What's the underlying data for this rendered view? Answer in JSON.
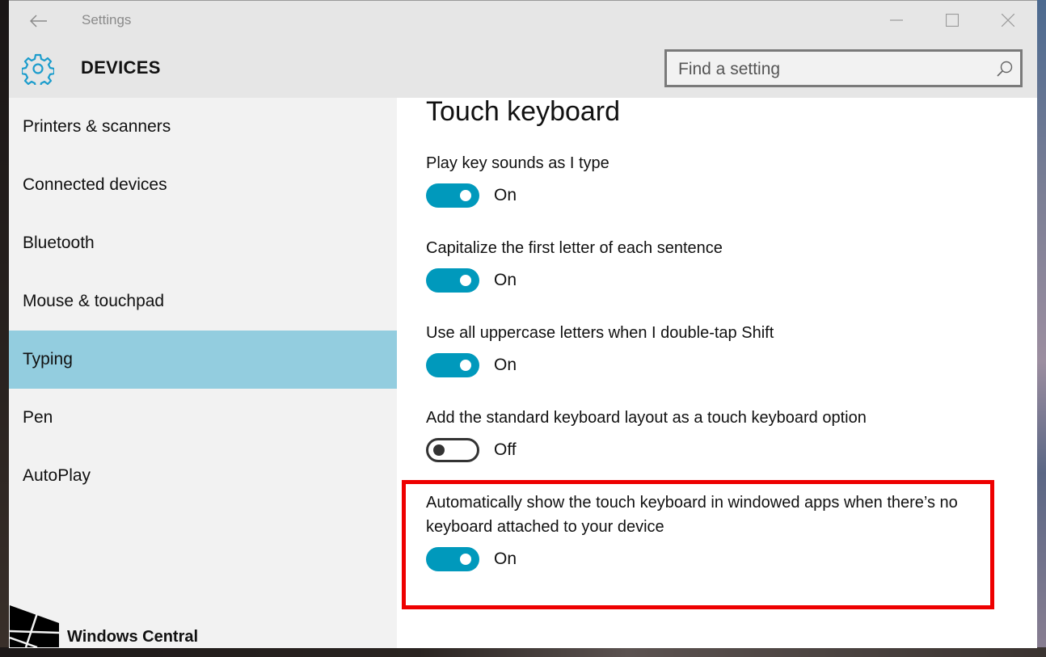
{
  "window": {
    "app_title": "Settings",
    "section_title": "DEVICES",
    "icons": {
      "back": "back-arrow-icon",
      "minimize": "minimize-icon",
      "maximize": "maximize-icon",
      "close": "close-icon",
      "section": "gear-icon",
      "search": "search-icon"
    }
  },
  "search": {
    "placeholder": "Find a setting",
    "value": ""
  },
  "sidebar": {
    "items": [
      {
        "label": "Printers & scanners",
        "selected": false
      },
      {
        "label": "Connected devices",
        "selected": false
      },
      {
        "label": "Bluetooth",
        "selected": false
      },
      {
        "label": "Mouse & touchpad",
        "selected": false
      },
      {
        "label": "Typing",
        "selected": true
      },
      {
        "label": "Pen",
        "selected": false
      },
      {
        "label": "AutoPlay",
        "selected": false
      }
    ]
  },
  "content": {
    "title": "Touch keyboard",
    "settings": [
      {
        "label": "Play key sounds as I type",
        "state": "On",
        "enabled": true
      },
      {
        "label": "Capitalize the first letter of each sentence",
        "state": "On",
        "enabled": true
      },
      {
        "label": "Use all uppercase letters when I double-tap Shift",
        "state": "On",
        "enabled": true
      },
      {
        "label": "Add the standard keyboard layout as a touch keyboard option",
        "state": "Off",
        "enabled": false
      },
      {
        "label": "Automatically show the touch keyboard in windowed apps when there’s no keyboard attached to your device",
        "state": "On",
        "enabled": true
      }
    ]
  },
  "watermark": {
    "text": "Windows Central"
  },
  "colors": {
    "accent": "#0099bc",
    "selected_nav": "#93cddf",
    "highlight": "#ee0000"
  }
}
